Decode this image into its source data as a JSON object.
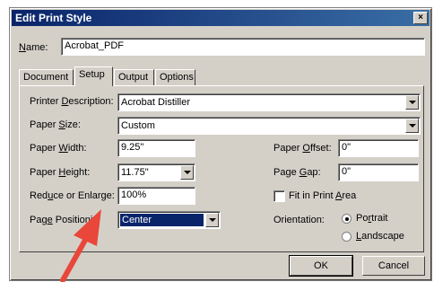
{
  "window": {
    "title": "Edit Print Style",
    "close_label": "×"
  },
  "name_row": {
    "label_u": "N",
    "label_rest": "ame:",
    "value": "Acrobat_PDF"
  },
  "tabs": [
    {
      "label": "Document",
      "active": false
    },
    {
      "label": "Setup",
      "active": true
    },
    {
      "label": "Output",
      "active": false
    },
    {
      "label": "Options",
      "active": false
    }
  ],
  "setup": {
    "printer_description": {
      "label_pre": "Printer ",
      "label_u": "D",
      "label_post": "escription:",
      "value": "Acrobat Distiller"
    },
    "paper_size": {
      "label_pre": "Paper ",
      "label_u": "S",
      "label_post": "ize:",
      "value": "Custom"
    },
    "paper_width": {
      "label_pre": "Paper ",
      "label_u": "W",
      "label_post": "idth:",
      "value": "9.25\""
    },
    "paper_height": {
      "label_pre": "Paper ",
      "label_u": "H",
      "label_post": "eight:",
      "value": "11.75\""
    },
    "reduce_enlarge": {
      "label_pre": "Red",
      "label_u": "u",
      "label_post": "ce or Enlarge:",
      "value": "100%"
    },
    "page_positioning": {
      "label_pre": "Pag",
      "label_u": "e",
      "label_post": " Positioni",
      "value": "Center"
    },
    "paper_offset": {
      "label_pre": "Paper ",
      "label_u": "O",
      "label_post": "ffset:",
      "value": "0\""
    },
    "page_gap": {
      "label_pre": "Page ",
      "label_u": "G",
      "label_post": "ap:",
      "value": "0\""
    },
    "fit_in_print_area": {
      "label_pre": "Fit in Print ",
      "label_u": "A",
      "label_post": "rea",
      "checked": false
    },
    "orientation": {
      "label": "Orientation:",
      "portrait": {
        "label_pre": "Po",
        "label_u": "r",
        "label_post": "trait",
        "selected": true
      },
      "landscape": {
        "label_u": "L",
        "label_post": "andscape",
        "selected": false
      }
    }
  },
  "buttons": {
    "ok": "OK",
    "cancel": "Cancel"
  },
  "colors": {
    "arrow": "#e8473a",
    "selection": "#0a246a",
    "titlebar": "#0a246a",
    "face": "#d4d0c8"
  }
}
